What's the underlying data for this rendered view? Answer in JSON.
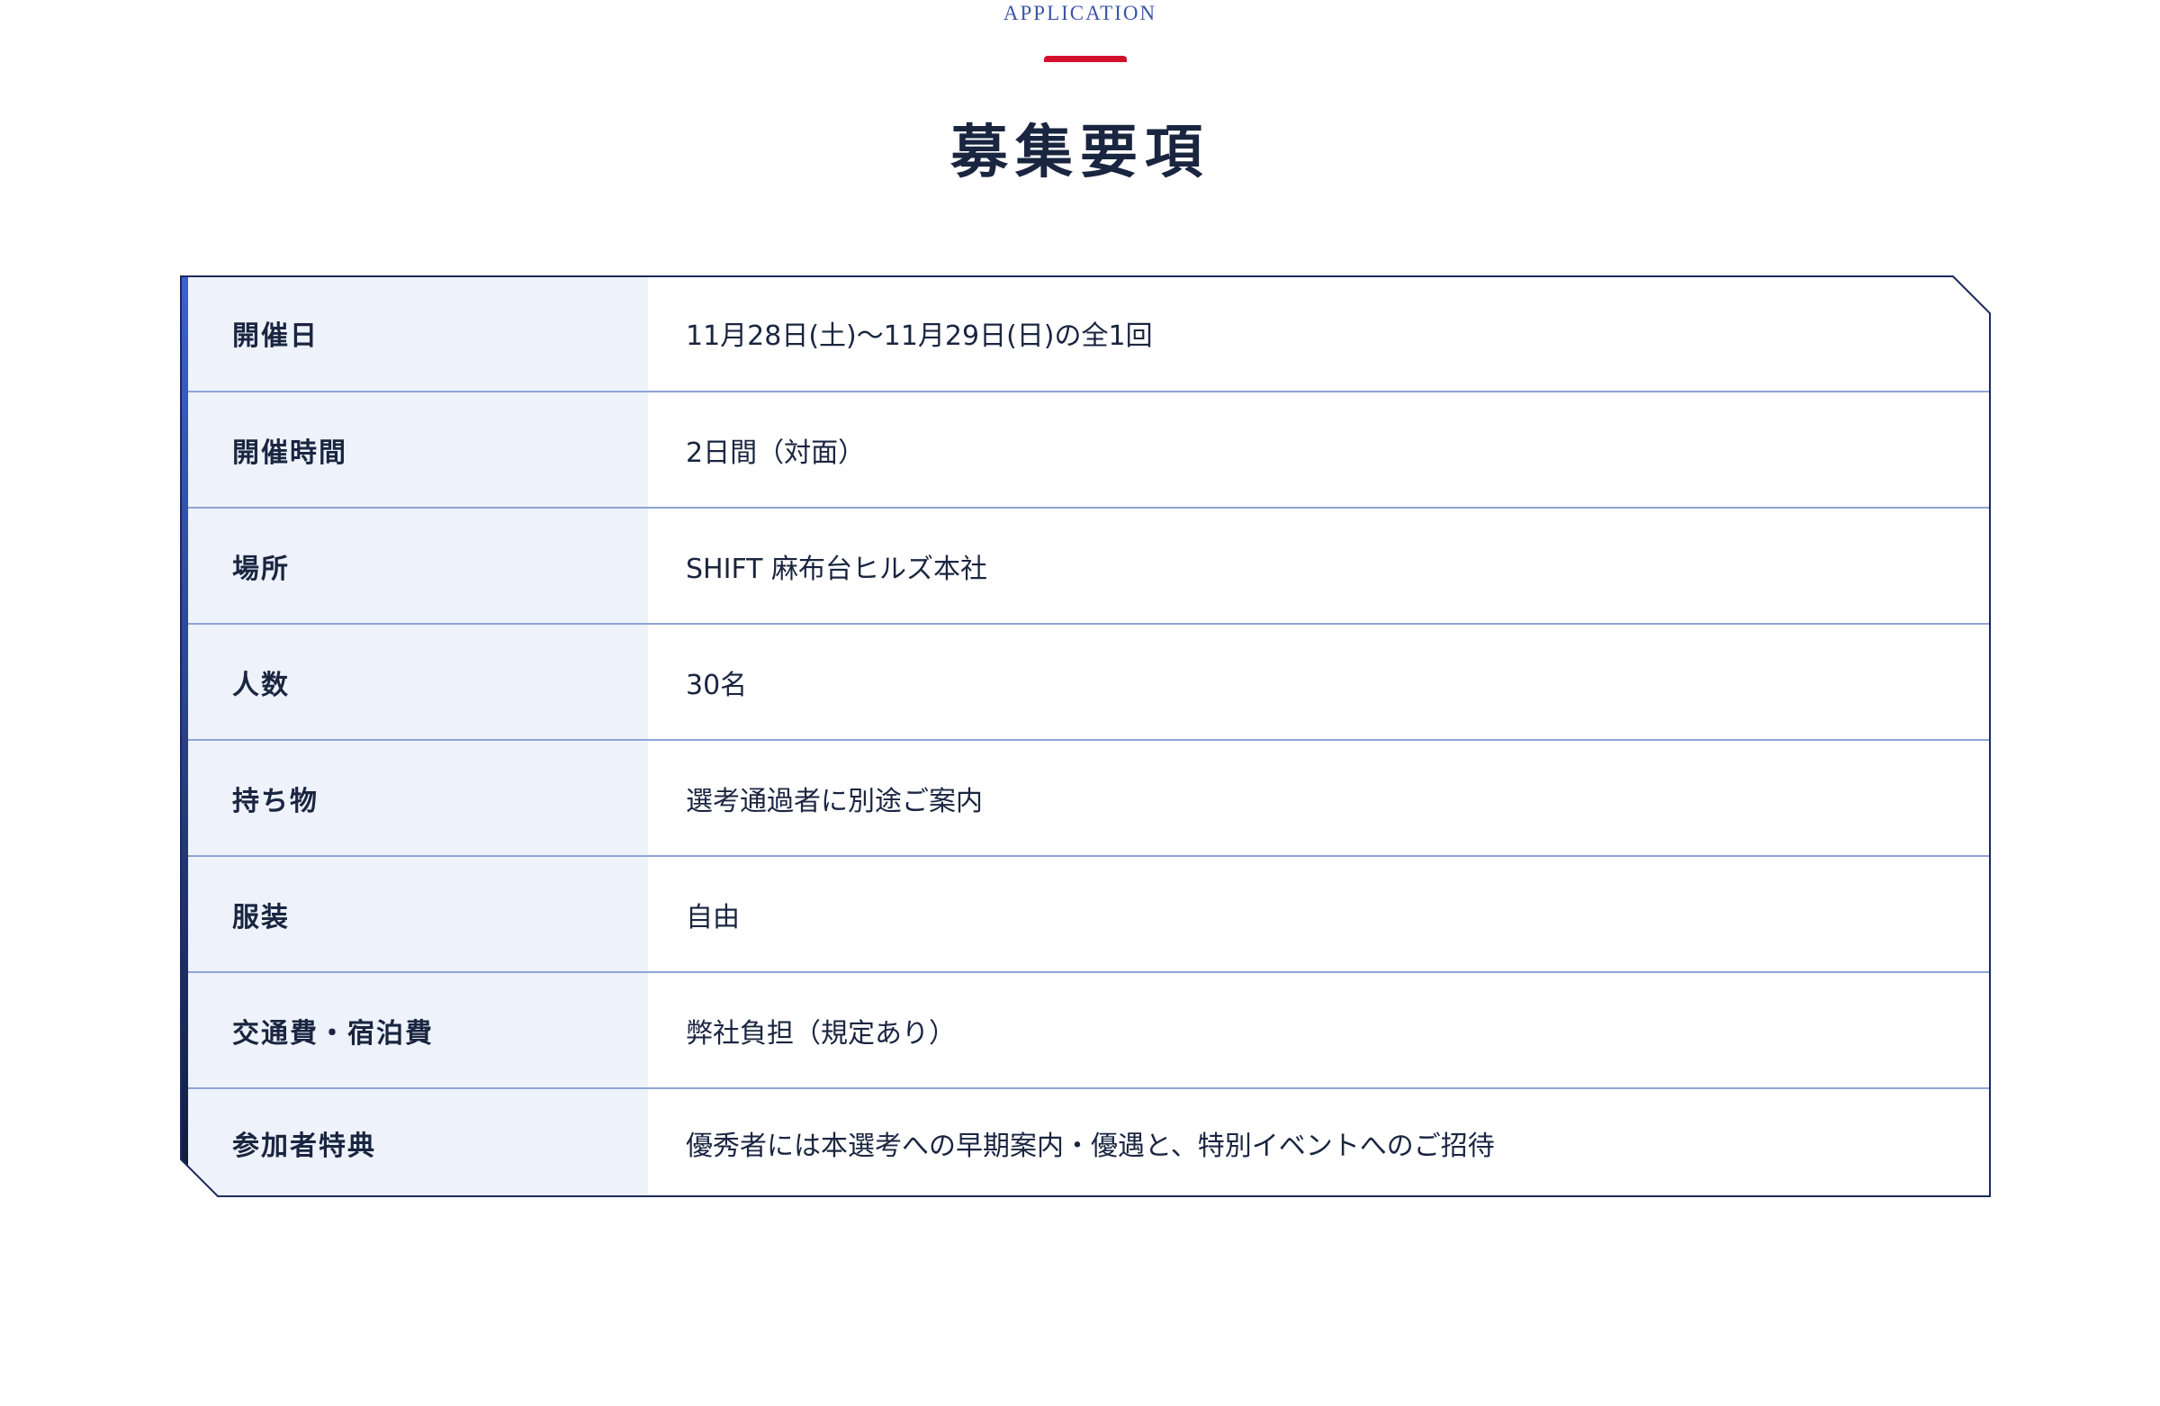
{
  "header": {
    "eyebrow": "APPLICATION",
    "title": "募集要項",
    "accent_color": "#d3102c"
  },
  "colors": {
    "label_background": "#edf2fb",
    "row_divider": "#8ea4d6",
    "frame_border": "#1b2a5c",
    "accent_gradient_top": "#3a62cf",
    "accent_gradient_bottom": "#111a36",
    "text": "#1a2540"
  },
  "table": {
    "rows": [
      {
        "label": "開催日",
        "value": "11月28日(土)〜11月29日(日)の全1回"
      },
      {
        "label": "開催時間",
        "value": "2日間（対面）"
      },
      {
        "label": "場所",
        "value": "SHIFT 麻布台ヒルズ本社"
      },
      {
        "label": "人数",
        "value": "30名"
      },
      {
        "label": "持ち物",
        "value": "選考通過者に別途ご案内"
      },
      {
        "label": "服装",
        "value": "自由"
      },
      {
        "label": "交通費・宿泊費",
        "value": "弊社負担（規定あり）"
      },
      {
        "label": "参加者特典",
        "value": "優秀者には本選考への早期案内・優遇と、特別イベントへのご招待"
      }
    ]
  }
}
